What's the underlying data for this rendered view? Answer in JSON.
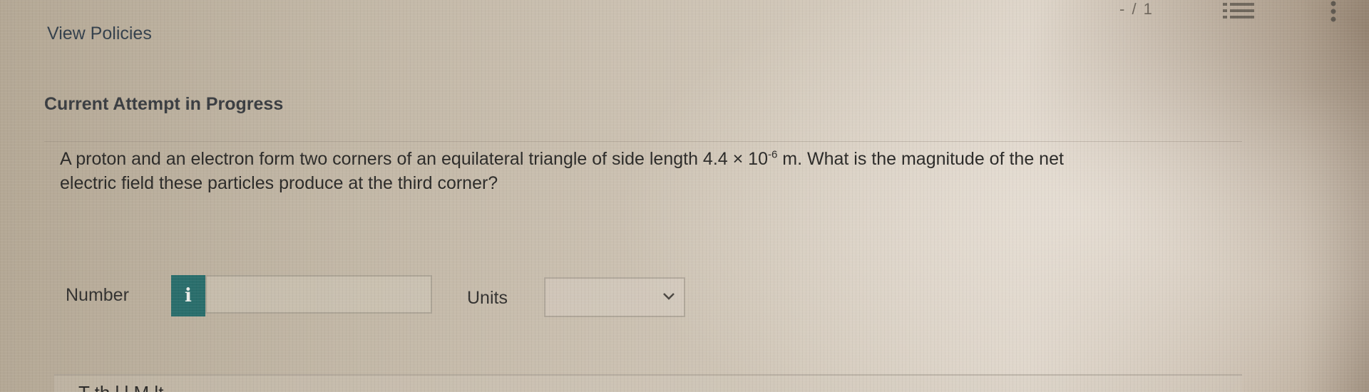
{
  "header": {
    "pager_fragment": "- / 1",
    "list_icon": "list-icon",
    "more_icon": "kebab-icon"
  },
  "policies_link": "View Policies",
  "attempt_heading": "Current Attempt in Progress",
  "question": {
    "line1_before_exp": "A proton and an electron form two corners of an equilateral triangle of side length 4.4 × 10",
    "exponent": "-6",
    "line1_after_exp": " m. What is the magnitude of the net",
    "line2": "electric field these particles produce at the third corner?"
  },
  "answer": {
    "number_label": "Number",
    "info_glyph": "i",
    "number_value": "",
    "units_label": "Units",
    "units_selected": ""
  },
  "lower_panel_text": "T  th  l    l  M  lt",
  "colors": {
    "info_button_bg": "#2a6e6c",
    "link_text": "#34404c"
  }
}
